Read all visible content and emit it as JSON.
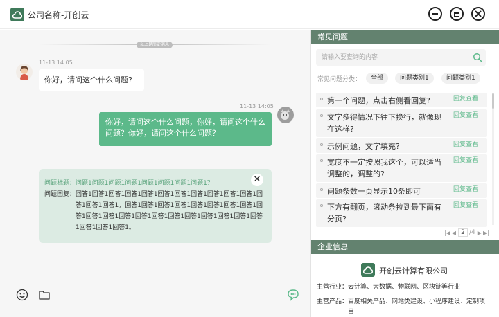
{
  "window": {
    "title": "公司名称-开创云",
    "logo_icon": "cloud-icon",
    "brand_color": "#3f7a5a"
  },
  "chat": {
    "history_divider": "以上是历史消息",
    "messages": [
      {
        "direction": "incoming",
        "timestamp": "11-13 14:05",
        "text": "你好，请问这个什么问题?"
      },
      {
        "direction": "outgoing",
        "timestamp": "11-13 14:05",
        "text": "你好，请问这个什么问题，你好，请问这个什么问题？你好，请问这个什么问题？"
      }
    ],
    "faq_card": {
      "question_label": "问题标题：",
      "question_text": "问题1问题1问题1问题1问题1问题1问题1问题1？",
      "answer_label": "问题回复：",
      "answer_text": "回答1回答1回答1回答1回答1回答1回答1回答1回答1回答1回答1回答1回答1回答1，回答1回答1回答1回答1回答1回答1回答1回答1回答1回答1回答1回答1回答1回答1回答1回答1回答1回答1回答1回答1回答1回答1回答1。"
    },
    "toolbar": {
      "emoji_icon": "smiley-icon",
      "file_icon": "folder-icon",
      "agent_icon": "chat-bubble-icon"
    },
    "accent_color": "#5cb98a"
  },
  "faq_panel": {
    "header": "常见问题",
    "search_placeholder": "请输入要查询的内容",
    "filter_label": "常见问题分类：",
    "categories": [
      "全部",
      "问题类别1",
      "问题类别1"
    ],
    "view_link_label": "回复查看",
    "items": [
      "第一个问题，点击右侧看回复?",
      "文字多得情况下往下换行，就像现在这样?",
      "示例问题，文字填充?",
      "宽度不一定按照我这个，可以适当调整的，调整的?",
      "问题条数一页显示10条即可",
      "下方有翻页，滚动条拉到最下面有分页?"
    ],
    "pagination": {
      "current": "2",
      "total": "/4"
    }
  },
  "company_panel": {
    "header": "企业信息",
    "name": "开创云计算有限公司",
    "industry_label": "主营行业：",
    "industry_value": "云计算、大数据、物联网、区块链等行业",
    "products_label": "主营产品：",
    "products_value": "百度相关产品、网站类建设、小程序建设、定制项目"
  }
}
